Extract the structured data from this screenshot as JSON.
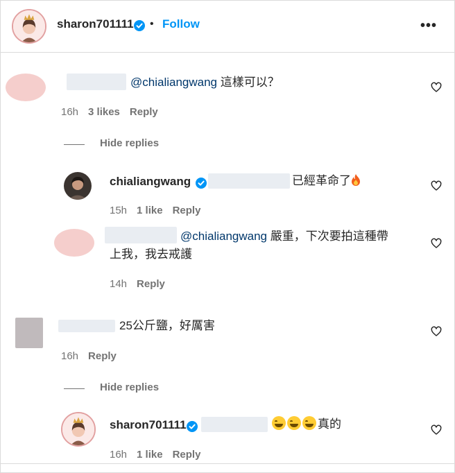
{
  "header": {
    "username": "sharon701111",
    "separator": "•",
    "follow_label": "Follow",
    "more_label": "•••"
  },
  "comments": [
    {
      "text_mention": "@chialiangwang",
      "text": " 這樣可以？",
      "time": "16h",
      "likes": "3 likes",
      "reply_label": "Reply",
      "hide_replies_label": "Hide replies",
      "replies": [
        {
          "username": "chialiangwang",
          "text": "已經革命了",
          "emoji": "fire",
          "time": "15h",
          "likes": "1 like",
          "reply_label": "Reply"
        },
        {
          "text_mention": "@chialiangwang",
          "text": " 嚴重，下次要拍這種帶",
          "text2": "上我，我去戒護",
          "time": "14h",
          "reply_label": "Reply"
        }
      ]
    },
    {
      "text": "25公斤鹽，好厲害",
      "time": "16h",
      "reply_label": "Reply",
      "hide_replies_label": "Hide replies",
      "replies": [
        {
          "username": "sharon701111",
          "emoji": "grinning-sweat x3",
          "text": "真的",
          "time": "16h",
          "likes": "1 like",
          "reply_label": "Reply"
        }
      ]
    }
  ],
  "colors": {
    "link_blue": "#0095f6",
    "mention": "#00376b",
    "meta_gray": "#737373",
    "verified_blue": "#0095f6"
  },
  "icons": [
    "verified-badge-icon",
    "heart-icon",
    "more-icon",
    "fire-emoji",
    "grinning-sweat-emoji"
  ]
}
